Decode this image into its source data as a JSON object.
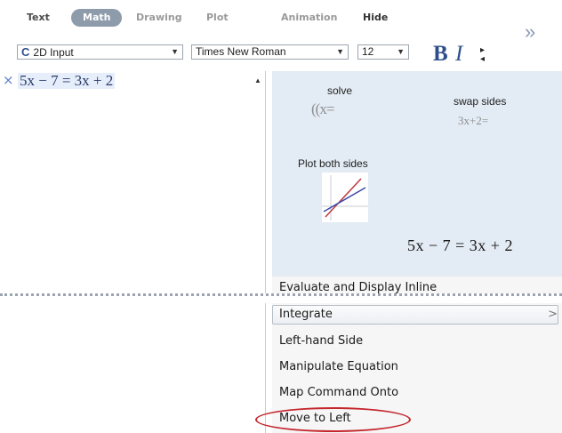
{
  "tabs": {
    "text": "Text",
    "math": "Math",
    "drawing": "Drawing",
    "plot": "Plot",
    "animation": "Animation",
    "hide": "Hide"
  },
  "toolbar": {
    "mode_icon": "C",
    "mode_value": "2D Input",
    "font_value": "Times New Roman",
    "size_value": "12",
    "bold": "B",
    "italic": "I"
  },
  "document": {
    "math_text": "5x − 7 = 3x + 2"
  },
  "context": {
    "solve_label": "solve",
    "solve_preview": "((x=",
    "swap_label": "swap sides",
    "swap_preview": "3x+2=",
    "plot_label": "Plot both sides",
    "equation": "5x − 7 = 3x + 2"
  },
  "menu": {
    "items": [
      "Evaluate and Display Inline",
      "Integrate",
      "Left-hand Side",
      "Manipulate Equation",
      "Map Command Onto",
      "Move to Left"
    ],
    "submenu_arrow": ">"
  },
  "colors": {
    "highlight_ring": "#c4262c",
    "accent": "#2e4f8c",
    "context_bg": "#e3ebf4"
  },
  "icons": [
    "execution-group-icon",
    "chevron-right-double-icon",
    "dropdown-arrow-icon",
    "plot-thumbnail-icon"
  ]
}
